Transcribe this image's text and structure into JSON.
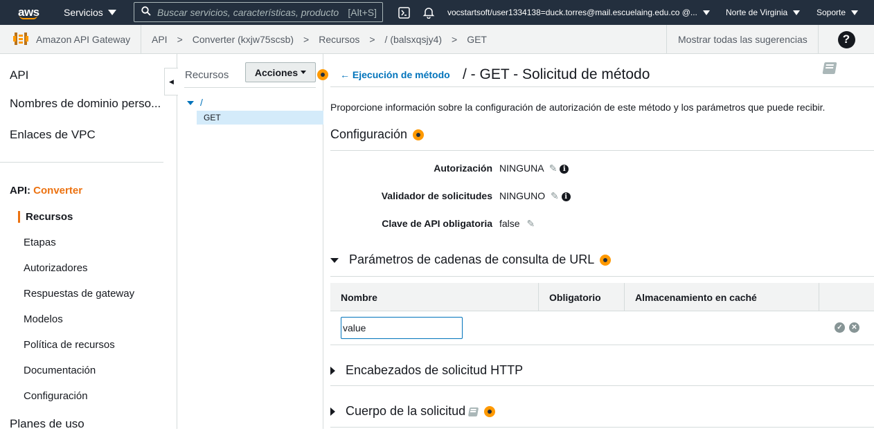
{
  "topbar": {
    "logo": "aws",
    "services_label": "Servicios",
    "search_placeholder": "Buscar servicios, características, producto",
    "search_hint": "[Alt+S]",
    "account": "vocstartsoft/user1334138=duck.torres@mail.escuelaing.edu.co @...",
    "region": "Norte de Virginia",
    "support": "Soporte",
    "icons": [
      "search-icon",
      "cloudshell-icon",
      "bell-icon",
      "help-icon",
      "book-icon",
      "info-icon",
      "pencil-icon"
    ]
  },
  "crumbbar": {
    "service": "Amazon API Gateway",
    "crumbs": [
      "API",
      "Converter (kxjw75scsb)",
      "Recursos",
      "/ (balsxqsjy4)",
      "GET"
    ],
    "separator": ">",
    "suggestions": "Mostrar todas las sugerencias",
    "help": "?"
  },
  "sidebar": {
    "top_items": [
      "API",
      "Nombres de dominio perso...",
      "Enlaces de VPC"
    ],
    "api_prefix": "API:",
    "api_name": "Converter",
    "items": [
      "Recursos",
      "Etapas",
      "Autorizadores",
      "Respuestas de gateway",
      "Modelos",
      "Política de recursos",
      "Documentación",
      "Configuración"
    ],
    "bottom_item": "Planes de uso",
    "active": "Recursos"
  },
  "tree": {
    "title": "Recursos",
    "actions_label": "Acciones",
    "root": "/",
    "selected": "GET"
  },
  "main": {
    "back_link": "Ejecución de método",
    "title": "/ - GET - Solicitud de método",
    "description": "Proporcione información sobre la configuración de autorización de este método y los parámetros que puede recibir.",
    "config_title": "Configuración",
    "fields": [
      {
        "label": "Autorización",
        "value": "NINGUNA"
      },
      {
        "label": "Validador de solicitudes",
        "value": "NINGUNO"
      },
      {
        "label": "Clave de API obligatoria",
        "value": "false"
      }
    ],
    "query_section": "Parámetros de cadenas de consulta de URL",
    "table_headers": [
      "Nombre",
      "Obligatorio",
      "Almacenamiento en caché"
    ],
    "input_value": "value",
    "headers_section": "Encabezados de solicitud HTTP",
    "body_section": "Cuerpo de la solicitud"
  },
  "colors": {
    "topbar": "#232f3e",
    "accent": "#ec7211",
    "link": "#0073bb"
  }
}
